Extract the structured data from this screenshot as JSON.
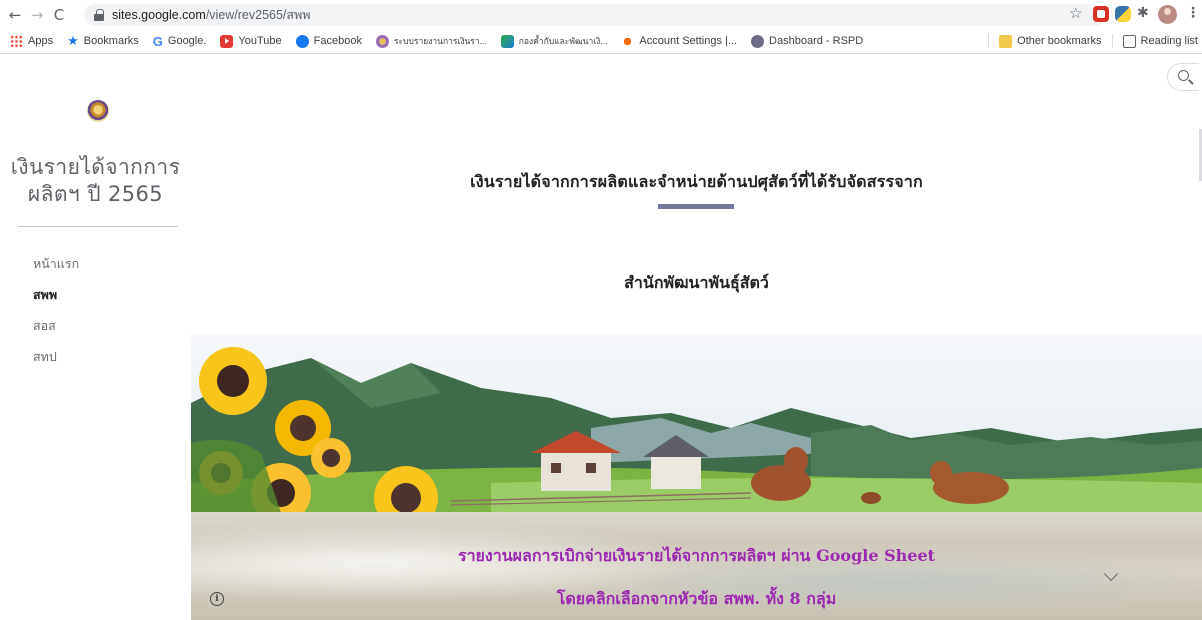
{
  "browser": {
    "url_host": "sites.google.com",
    "url_path": "/view/rev2565/สพพ",
    "bookmarks": [
      {
        "label": "Apps",
        "icon": "apps-grid-icon"
      },
      {
        "label": "Bookmarks",
        "icon": "star-icon"
      },
      {
        "label": "Google.",
        "icon": "google-icon"
      },
      {
        "label": "YouTube",
        "icon": "youtube-icon"
      },
      {
        "label": "Facebook",
        "icon": "facebook-icon"
      },
      {
        "label": "ระบบรายงานการเงินรา...",
        "icon": "seal-icon"
      },
      {
        "label": "กองค้ำกับและพัฒนาเงิ...",
        "icon": "leaf-icon"
      },
      {
        "label": "Account Settings |...",
        "icon": "settings-icon"
      },
      {
        "label": "Dashboard - RSPD",
        "icon": "dashboard-icon"
      }
    ],
    "other_bookmarks": "Other bookmarks",
    "reading_list": "Reading list"
  },
  "site": {
    "title_line1": "เงินรายได้จากการ",
    "title_line2": "ผลิตฯ ปี 2565",
    "nav": [
      {
        "label": "หน้าแรก",
        "active": false
      },
      {
        "label": "สพพ",
        "active": true
      },
      {
        "label": "สอส",
        "active": false
      },
      {
        "label": "สทป",
        "active": false
      }
    ]
  },
  "main": {
    "heading": "เงินรายได้จากการผลิตและจำหน่ายด้านปศุสัตว์ที่ได้รับจัดสรรจาก",
    "subheading": "สำนักพัฒนาพันธุ์สัตว์",
    "report_line1": "รายงานผลการเบิกจ่ายเงินรายได้จากการผลิตฯ ผ่าน Google Sheet",
    "report_line2": "โดยคลิกเลือกจากหัวข้อ สพพ. ทั้ง 8 กลุ่ม"
  },
  "colors": {
    "accent_bar": "#747a9d",
    "report_text": "#9c27b0"
  }
}
